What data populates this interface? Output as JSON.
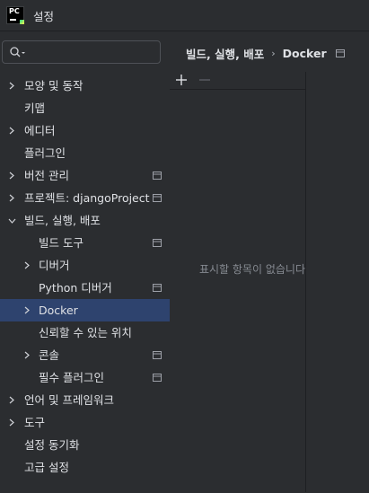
{
  "window": {
    "title": "설정",
    "logo_text": "PC"
  },
  "search": {
    "placeholder": ""
  },
  "tree": {
    "appearance": "모양 및 동작",
    "keymap": "키맵",
    "editor": "에디터",
    "plugins": "플러그인",
    "vcs": "버전 관리",
    "project": "프로젝트: djangoProject",
    "build": "빌드, 실행, 배포",
    "build_tools": "빌드 도구",
    "debugger": "디버거",
    "python_debugger": "Python 디버거",
    "docker": "Docker",
    "trusted_locations": "신뢰할 수 있는 위치",
    "console": "콘솔",
    "required_plugins": "필수 플러그인",
    "languages": "언어 및 프레임워크",
    "tools": "도구",
    "settings_sync": "설정 동기화",
    "advanced": "고급 설정"
  },
  "breadcrumb": {
    "parent": "빌드, 실행, 배포",
    "separator": "›",
    "current": "Docker"
  },
  "list": {
    "empty_text": "표시할 항목이 없습니다"
  },
  "colors": {
    "background": "#2b2d30",
    "selection": "#2e436e",
    "text": "#dfe1e5",
    "muted": "#868a91"
  }
}
